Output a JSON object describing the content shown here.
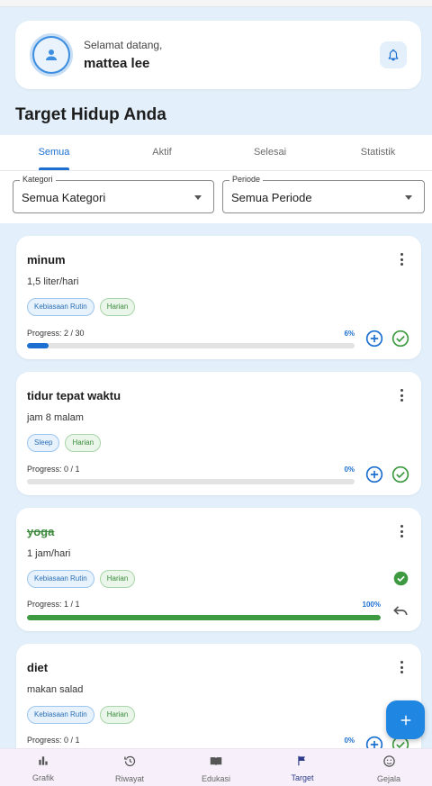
{
  "header": {
    "greeting": "Selamat datang,",
    "username": "mattea lee"
  },
  "page_title": "Target Hidup Anda",
  "tabs": [
    "Semua",
    "Aktif",
    "Selesai",
    "Statistik"
  ],
  "filters": {
    "kategori": {
      "legend": "Kategori",
      "value": "Semua Kategori"
    },
    "periode": {
      "legend": "Periode",
      "value": "Semua Periode"
    }
  },
  "targets": [
    {
      "title": "minum",
      "desc": "1,5 liter/hari",
      "chips": [
        "Kebiasaan Rutin",
        "Harian"
      ],
      "progress_text": "Progress: 2 / 30",
      "percent": "6%",
      "fraction": 0.0667,
      "completed": false
    },
    {
      "title": "tidur tepat waktu",
      "desc": "jam 8 malam",
      "chips": [
        "Sleep",
        "Harian"
      ],
      "progress_text": "Progress: 0 / 1",
      "percent": "0%",
      "fraction": 0,
      "completed": false
    },
    {
      "title": "yoga",
      "desc": "1 jam/hari",
      "chips": [
        "Kebiasaan Rutin",
        "Harian"
      ],
      "progress_text": "Progress: 1 / 1",
      "percent": "100%",
      "fraction": 1,
      "completed": true
    },
    {
      "title": "diet",
      "desc": "makan salad",
      "chips": [
        "Kebiasaan Rutin",
        "Harian"
      ],
      "progress_text": "Progress: 0 / 1",
      "percent": "0%",
      "fraction": 0,
      "completed": false
    }
  ],
  "bottom_nav": [
    {
      "label": "Grafik",
      "icon": "bar-chart-icon"
    },
    {
      "label": "Riwayat",
      "icon": "history-icon"
    },
    {
      "label": "Edukasi",
      "icon": "book-icon"
    },
    {
      "label": "Target",
      "icon": "flag-icon",
      "active": true
    },
    {
      "label": "Gejala",
      "icon": "face-icon"
    }
  ],
  "colors": {
    "primary": "#1c6fd0",
    "success": "#3d9a40",
    "background": "#e3f0fb"
  }
}
